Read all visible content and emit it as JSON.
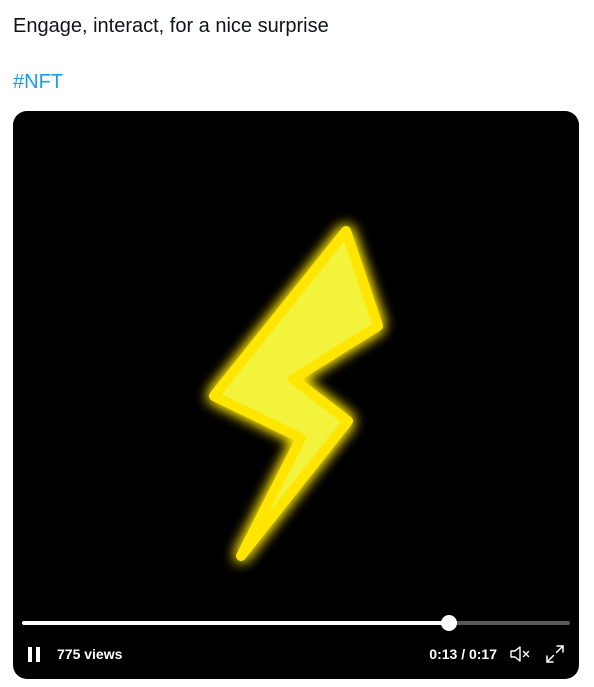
{
  "tweet": {
    "text": "Engage, interact, for a nice surprise",
    "hashtag": "#NFT"
  },
  "video": {
    "artwork": "yellow-lightning-bolt",
    "bolt_color": "#f3f33a",
    "glow_color": "#ffe600",
    "background": "#000000",
    "progress_fraction": 0.78,
    "views_label": "775 views",
    "time_label": "0:13 / 0:17",
    "play_state_icon": "pause-icon",
    "mute_icon": "muted-speaker-icon",
    "fullscreen_icon": "expand-icon"
  },
  "colors": {
    "text": "#0f1419",
    "link": "#1d9bf0"
  }
}
